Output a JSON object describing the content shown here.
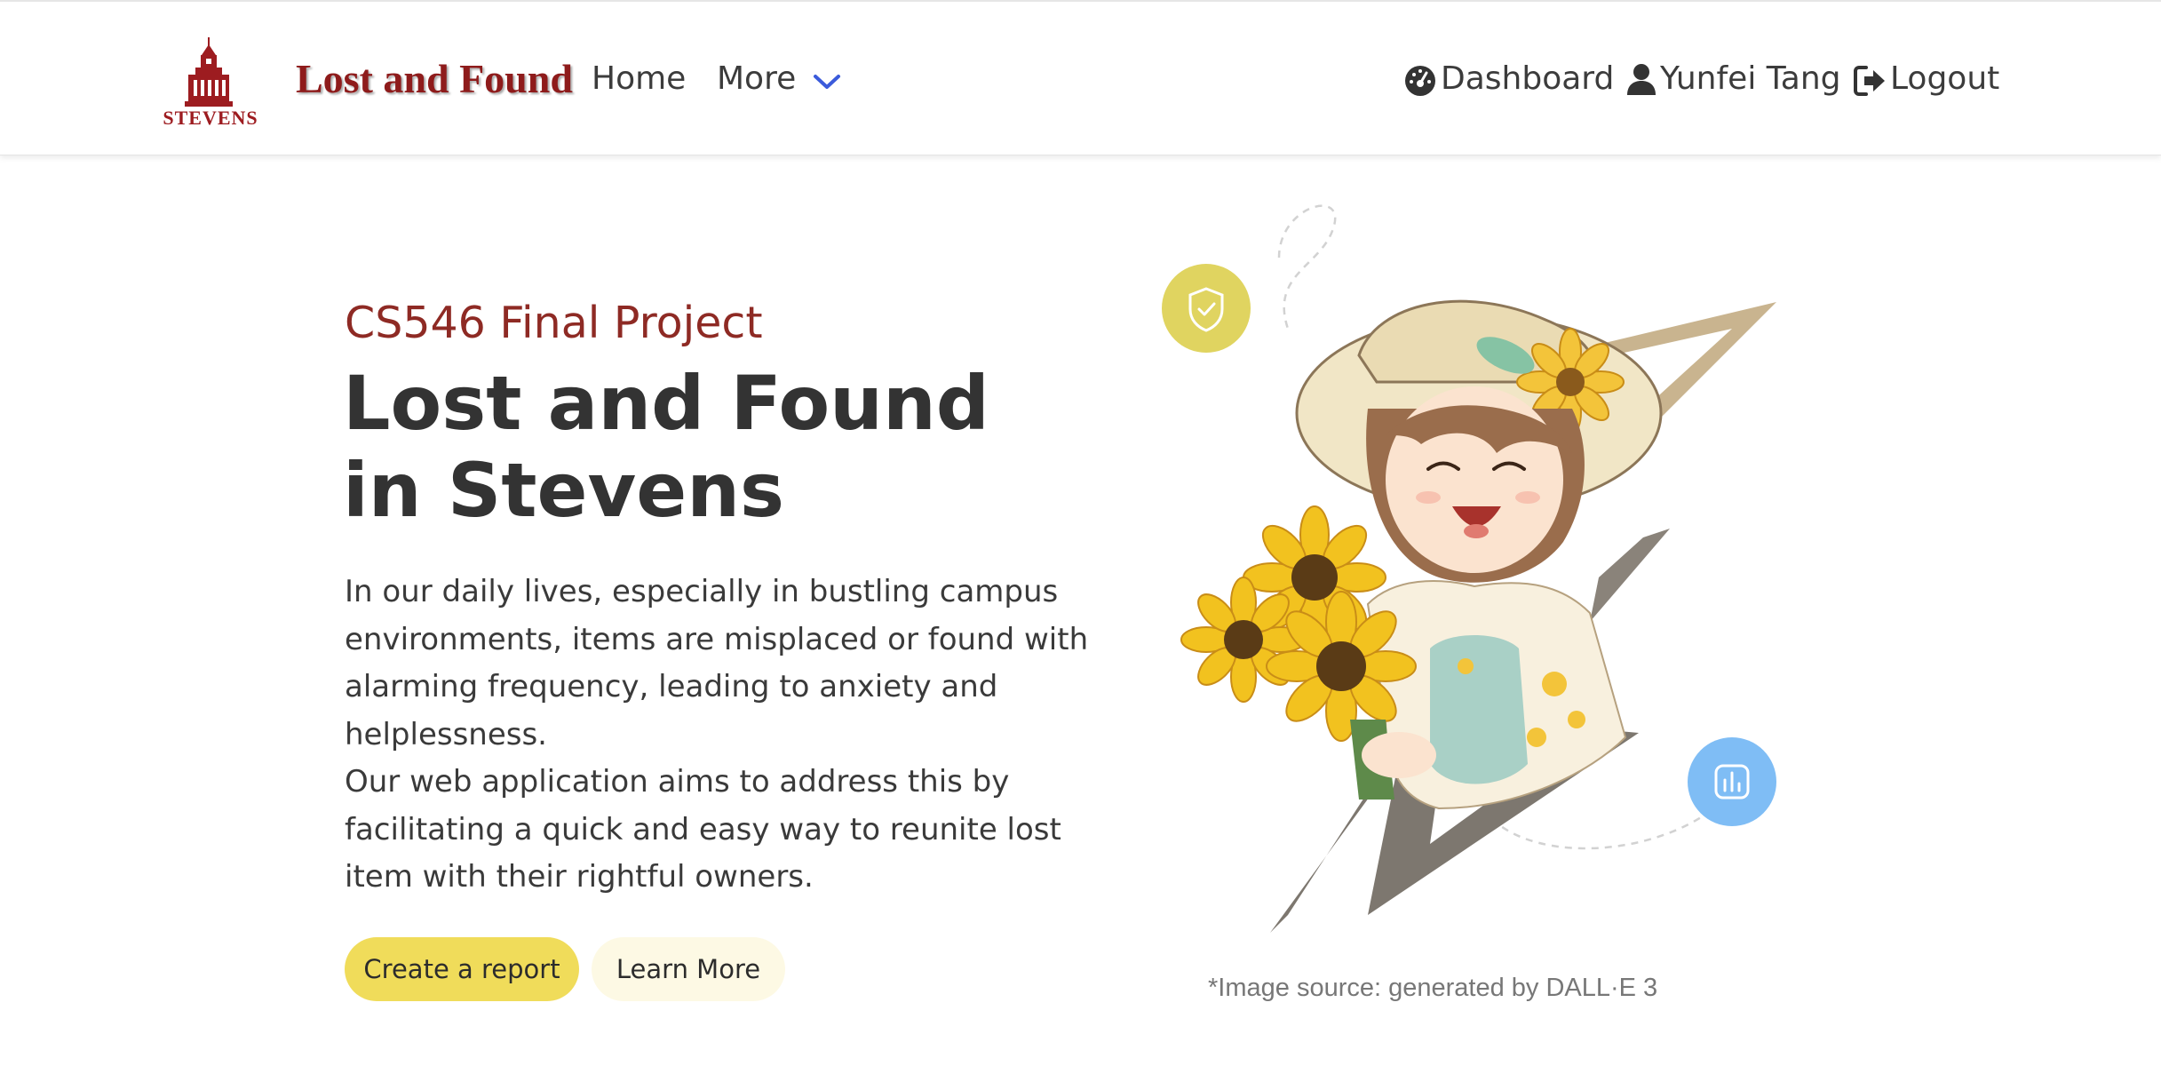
{
  "navbar": {
    "logo_text": "STEVENS",
    "brand_title": "Lost and Found",
    "home_label": "Home",
    "more_label": "More",
    "dashboard_label": "Dashboard",
    "user_label": "Yunfei Tang",
    "logout_label": "Logout"
  },
  "hero": {
    "eyebrow": "CS546 Final Project",
    "title_line1": "Lost and Found",
    "title_line2": "in Stevens",
    "desc_p1": "In our daily lives, especially in bustling campus environments, items are misplaced or found with alarming frequency, leading to anxiety and helplessness.",
    "desc_p2": "Our web application aims to address this by facilitating a quick and easy way to reunite lost item with their rightful owners.",
    "primary_button": "Create a report",
    "secondary_button": "Learn More"
  },
  "illustration": {
    "caption": "*Image source: generated by DALL·E 3"
  },
  "colors": {
    "brand_red": "#8e1b1b",
    "primary_yellow": "#f0dc5a",
    "secondary_cream": "#fdf9e4",
    "accent_blue": "#7fbdf5",
    "badge_yellow": "#e0d460"
  }
}
